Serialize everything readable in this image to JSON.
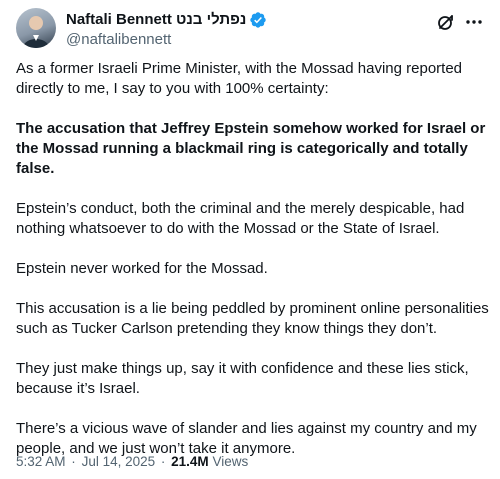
{
  "author": {
    "display_name": "Naftali Bennett נפתלי בנט",
    "handle": "@naftalibennett"
  },
  "icons": {
    "verified": "verified-badge-icon",
    "grok": "grok-icon",
    "more": "more-options-icon",
    "verified_color": "#1d9bf0"
  },
  "tweet": {
    "paragraphs": [
      "As a former Israeli Prime Minister, with the Mossad having reported directly to me, I say to you with 100% certainty:",
      "The accusation that Jeffrey Epstein somehow worked for Israel or the Mossad running a blackmail ring is categorically and totally false.",
      "Epstein’s conduct, both the criminal and the merely despicable, had nothing whatsoever to do with the Mossad or the State of Israel.",
      "Epstein never worked for the Mossad.",
      "This accusation is a lie being peddled by prominent online personalities such as Tucker Carlson pretending they know things they don’t.",
      "They just make things up, say it with confidence and these lies stick, because it’s Israel.",
      "There’s a vicious wave of slander and lies against my country and my people, and we just won’t take it anymore."
    ]
  },
  "meta": {
    "time": "5:32 AM",
    "separator": "·",
    "date": "Jul 14, 2025",
    "views_count": "21.4M",
    "views_label": "Views"
  }
}
